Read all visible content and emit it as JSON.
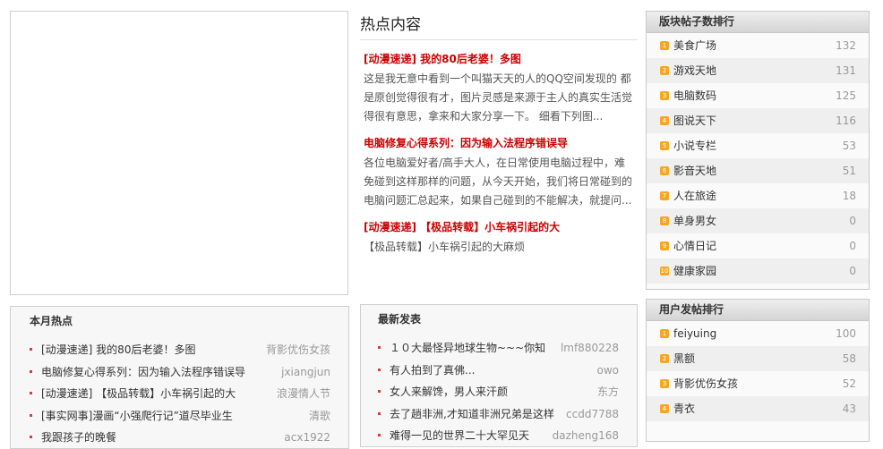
{
  "hot_content": {
    "title": "热点内容",
    "items": [
      {
        "title": "[动漫速递] 我的80后老婆！多图",
        "desc": "这是我无意中看到一个叫猫天天的人的QQ空间发现的 都是原创觉得很有才，图片灵感是来源于主人的真实生活觉得很有意思，拿来和大家分享一下。 细看下列图..."
      },
      {
        "title": "电脑修复心得系列：因为输入法程序错误导",
        "desc": "各位电脑爱好者/高手大人，在日常使用电脑过程中，难免碰到这样那样的问题，从今天开始，我们将日常碰到的电脑问题汇总起来，如果自己碰到的不能解决，就提问..."
      },
      {
        "title": "[动漫速递] 【极品转载】小车祸引起的大",
        "desc": "【极品转载】小车祸引起的大麻烦"
      }
    ]
  },
  "section_rank": {
    "title": "版块帖子数排行",
    "items": [
      {
        "num": "1",
        "name": "美食广场",
        "count": "132"
      },
      {
        "num": "2",
        "name": "游戏天地",
        "count": "131"
      },
      {
        "num": "3",
        "name": "电脑数码",
        "count": "125"
      },
      {
        "num": "4",
        "name": "图说天下",
        "count": "116"
      },
      {
        "num": "5",
        "name": "小说专栏",
        "count": "53"
      },
      {
        "num": "6",
        "name": "影音天地",
        "count": "51"
      },
      {
        "num": "7",
        "name": "人在旅途",
        "count": "18"
      },
      {
        "num": "8",
        "name": "单身男女",
        "count": "0"
      },
      {
        "num": "9",
        "name": "心情日记",
        "count": "0"
      },
      {
        "num": "10",
        "name": "健康家园",
        "count": "0"
      }
    ]
  },
  "user_rank": {
    "title": "用户发帖排行",
    "items": [
      {
        "num": "1",
        "name": "feiyuing",
        "count": "100"
      },
      {
        "num": "2",
        "name": "黑额",
        "count": "58"
      },
      {
        "num": "3",
        "name": "背影优伤女孩",
        "count": "52"
      },
      {
        "num": "4",
        "name": "青衣",
        "count": "43"
      }
    ]
  },
  "month_hot": {
    "title": "本月热点",
    "items": [
      {
        "title": "[动漫速递] 我的80后老婆！多图",
        "author": "背影优伤女孩"
      },
      {
        "title": "电脑修复心得系列：因为输入法程序错误导",
        "author": "jxiangjun"
      },
      {
        "title": "[动漫速递] 【极品转载】小车祸引起的大",
        "author": "浪漫情人节"
      },
      {
        "title": "[事实网事]漫画“小强爬行记”道尽毕业生",
        "author": "清歌"
      },
      {
        "title": "我跟孩子的晚餐",
        "author": "acx1922"
      }
    ]
  },
  "latest": {
    "title": "最新发表",
    "items": [
      {
        "title": "１０大最怪异地球生物~~~你知",
        "author": "lmf880228"
      },
      {
        "title": "有人拍到了真佛...",
        "author": "owo"
      },
      {
        "title": "女人来解馋，男人来汗颜",
        "author": "东方"
      },
      {
        "title": "去了趟非洲,才知道非洲兄弟是这样",
        "author": "ccdd7788"
      },
      {
        "title": "难得一见的世界二十大罕见天",
        "author": "dazheng168"
      }
    ]
  },
  "colors": {
    "accent_red": "#cc0000",
    "rank_badge": "#f5a623",
    "bullet": "#d04040"
  }
}
